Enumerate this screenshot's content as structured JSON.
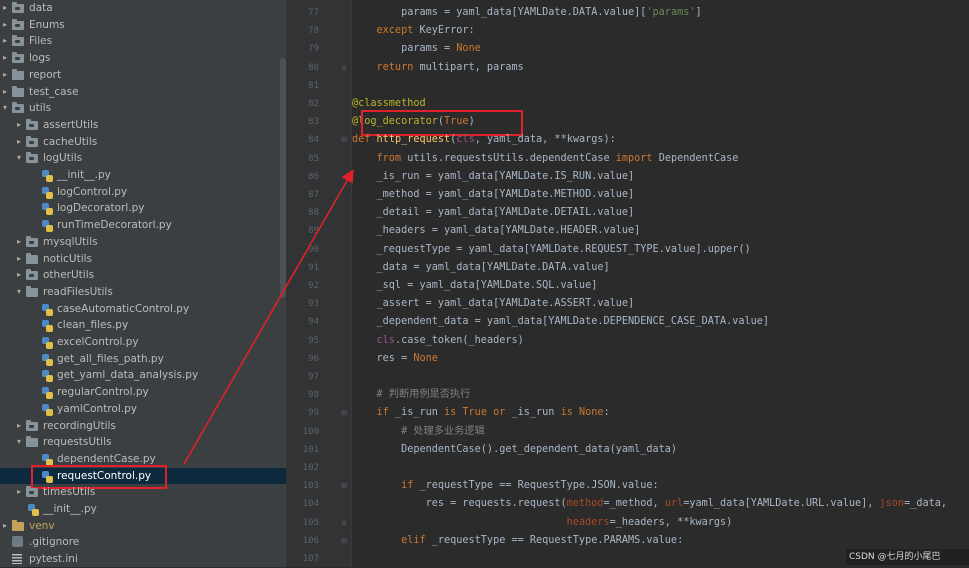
{
  "project_tree": [
    {
      "label": "data",
      "kind": "pkg",
      "depth": 0,
      "expanded": false
    },
    {
      "label": "Enums",
      "kind": "pkg",
      "depth": 0,
      "expanded": false
    },
    {
      "label": "Files",
      "kind": "pkg",
      "depth": 0,
      "expanded": false
    },
    {
      "label": "logs",
      "kind": "pkg",
      "depth": 0,
      "expanded": false
    },
    {
      "label": "report",
      "kind": "folder",
      "depth": 0,
      "expanded": false
    },
    {
      "label": "test_case",
      "kind": "folder",
      "depth": 0,
      "expanded": false
    },
    {
      "label": "utils",
      "kind": "pkg",
      "depth": 0,
      "expanded": true
    },
    {
      "label": "assertUtils",
      "kind": "pkg",
      "depth": 1,
      "expanded": false
    },
    {
      "label": "cacheUtils",
      "kind": "pkg",
      "depth": 1,
      "expanded": false
    },
    {
      "label": "logUtils",
      "kind": "pkg",
      "depth": 1,
      "expanded": true
    },
    {
      "label": "__init__.py",
      "kind": "py",
      "depth": 2
    },
    {
      "label": "logControl.py",
      "kind": "py",
      "depth": 2
    },
    {
      "label": "logDecoratorl.py",
      "kind": "py",
      "depth": 2
    },
    {
      "label": "runTimeDecoratorl.py",
      "kind": "py",
      "depth": 2
    },
    {
      "label": "mysqlUtils",
      "kind": "pkg",
      "depth": 1,
      "expanded": false
    },
    {
      "label": "noticUtils",
      "kind": "folder",
      "depth": 1,
      "expanded": false
    },
    {
      "label": "otherUtils",
      "kind": "pkg",
      "depth": 1,
      "expanded": false
    },
    {
      "label": "readFilesUtils",
      "kind": "folder",
      "depth": 1,
      "expanded": true
    },
    {
      "label": "caseAutomaticControl.py",
      "kind": "py",
      "depth": 2
    },
    {
      "label": "clean_files.py",
      "kind": "py",
      "depth": 2
    },
    {
      "label": "excelControl.py",
      "kind": "py",
      "depth": 2
    },
    {
      "label": "get_all_files_path.py",
      "kind": "py",
      "depth": 2
    },
    {
      "label": "get_yaml_data_analysis.py",
      "kind": "py",
      "depth": 2
    },
    {
      "label": "regularControl.py",
      "kind": "py",
      "depth": 2
    },
    {
      "label": "yamlControl.py",
      "kind": "py",
      "depth": 2
    },
    {
      "label": "recordingUtils",
      "kind": "pkg",
      "depth": 1,
      "expanded": false
    },
    {
      "label": "requestsUtils",
      "kind": "folder",
      "depth": 1,
      "expanded": true
    },
    {
      "label": "dependentCase.py",
      "kind": "py",
      "depth": 2
    },
    {
      "label": "requestControl.py",
      "kind": "py",
      "depth": 2,
      "selected": true,
      "highlighted": true
    },
    {
      "label": "timesUtils",
      "kind": "pkg",
      "depth": 1,
      "expanded": false
    },
    {
      "label": "__init__.py",
      "kind": "py",
      "depth": 1
    },
    {
      "label": "venv",
      "kind": "venv",
      "depth": 0,
      "expanded": false
    },
    {
      "label": ".gitignore",
      "kind": "git",
      "depth": 0
    },
    {
      "label": "pytest.ini",
      "kind": "ini",
      "depth": 0
    }
  ],
  "editor": {
    "lines": [
      {
        "n": "77",
        "fold": "",
        "tokens": [
          [
            "default",
            "        params = yaml_data[YAMLDate.DATA.value]["
          ],
          [
            "str",
            "'params'"
          ],
          [
            "default",
            "]"
          ]
        ]
      },
      {
        "n": "78",
        "fold": "",
        "tokens": [
          [
            "kw",
            "    except "
          ],
          [
            "default",
            "KeyError:"
          ]
        ]
      },
      {
        "n": "79",
        "fold": "",
        "tokens": [
          [
            "default",
            "        params = "
          ],
          [
            "kw",
            "None"
          ]
        ]
      },
      {
        "n": "80",
        "fold": "⌂",
        "tokens": [
          [
            "kw",
            "    return "
          ],
          [
            "default",
            "multipart, params"
          ]
        ]
      },
      {
        "n": "81",
        "fold": "",
        "tokens": []
      },
      {
        "n": "82",
        "fold": "",
        "tokens": [
          [
            "deco",
            "@classmethod"
          ]
        ]
      },
      {
        "n": "83",
        "fold": "",
        "highlighted": true,
        "tokens": [
          [
            "deco",
            "@log_decorator"
          ],
          [
            "default",
            "("
          ],
          [
            "kw",
            "True"
          ],
          [
            "default",
            ")"
          ]
        ]
      },
      {
        "n": "84",
        "fold": "⊖",
        "tokens": [
          [
            "kw",
            "def "
          ],
          [
            "fn",
            "http_request"
          ],
          [
            "default",
            "("
          ],
          [
            "self",
            "cls"
          ],
          [
            "default",
            ", yaml_data, **kwargs):"
          ]
        ]
      },
      {
        "n": "85",
        "fold": "",
        "tokens": [
          [
            "kw",
            "    from "
          ],
          [
            "default",
            "utils.requestsUtils.dependentCase "
          ],
          [
            "kw",
            "import "
          ],
          [
            "default",
            "DependentCase"
          ]
        ]
      },
      {
        "n": "86",
        "fold": "",
        "tokens": [
          [
            "default",
            "    _is_run = yaml_data[YAMLDate.IS_RUN.value]"
          ]
        ]
      },
      {
        "n": "87",
        "fold": "",
        "tokens": [
          [
            "default",
            "    _method = yaml_data[YAMLDate.METHOD.value]"
          ]
        ]
      },
      {
        "n": "88",
        "fold": "",
        "tokens": [
          [
            "default",
            "    _detail = yaml_data[YAMLDate.DETAIL.value]"
          ]
        ]
      },
      {
        "n": "89",
        "fold": "",
        "tokens": [
          [
            "default",
            "    _headers = yaml_data[YAMLDate.HEADER.value]"
          ]
        ]
      },
      {
        "n": "90",
        "fold": "",
        "tokens": [
          [
            "default",
            "    _requestType = yaml_data[YAMLDate.REQUEST_TYPE.value].upper()"
          ]
        ]
      },
      {
        "n": "91",
        "fold": "",
        "tokens": [
          [
            "default",
            "    _data = yaml_data[YAMLDate.DATA.value]"
          ]
        ]
      },
      {
        "n": "92",
        "fold": "",
        "tokens": [
          [
            "default",
            "    _sql = yaml_data[YAMLDate.SQL.value]"
          ]
        ]
      },
      {
        "n": "93",
        "fold": "",
        "tokens": [
          [
            "default",
            "    _assert = yaml_data[YAMLDate.ASSERT.value]"
          ]
        ]
      },
      {
        "n": "94",
        "fold": "",
        "tokens": [
          [
            "default",
            "    _dependent_data = yaml_data[YAMLDate.DEPENDENCE_CASE_DATA.value]"
          ]
        ]
      },
      {
        "n": "95",
        "fold": "",
        "tokens": [
          [
            "self",
            "    cls"
          ],
          [
            "default",
            ".case_token(_headers)"
          ]
        ]
      },
      {
        "n": "96",
        "fold": "",
        "tokens": [
          [
            "default",
            "    res = "
          ],
          [
            "kw",
            "None"
          ]
        ]
      },
      {
        "n": "97",
        "fold": "",
        "tokens": []
      },
      {
        "n": "98",
        "fold": "",
        "tokens": [
          [
            "comment",
            "    # 判断用例是否执行"
          ]
        ]
      },
      {
        "n": "99",
        "fold": "⊖",
        "tokens": [
          [
            "kw",
            "    if "
          ],
          [
            "default",
            "_is_run "
          ],
          [
            "kw",
            "is True or "
          ],
          [
            "default",
            "_is_run "
          ],
          [
            "kw",
            "is None"
          ],
          [
            "default",
            ":"
          ]
        ]
      },
      {
        "n": "100",
        "fold": "",
        "tokens": [
          [
            "comment",
            "        # 处理多业务逻辑"
          ]
        ]
      },
      {
        "n": "101",
        "fold": "",
        "tokens": [
          [
            "default",
            "        DependentCase().get_dependent_data(yaml_data)"
          ]
        ]
      },
      {
        "n": "102",
        "fold": "",
        "tokens": []
      },
      {
        "n": "103",
        "fold": "⊖",
        "tokens": [
          [
            "kw",
            "        if "
          ],
          [
            "default",
            "_requestType == RequestType.JSON.value:"
          ]
        ]
      },
      {
        "n": "104",
        "fold": "",
        "tokens": [
          [
            "default",
            "            res = requests.request("
          ],
          [
            "param",
            "method"
          ],
          [
            "default",
            "=_method, "
          ],
          [
            "param",
            "url"
          ],
          [
            "default",
            "=yaml_data[YAMLDate.URL.value], "
          ],
          [
            "param",
            "json"
          ],
          [
            "default",
            "=_data,"
          ]
        ]
      },
      {
        "n": "105",
        "fold": "⌂",
        "tokens": [
          [
            "default",
            "                                   "
          ],
          [
            "param",
            "headers"
          ],
          [
            "default",
            "=_headers, **kwargs)"
          ]
        ]
      },
      {
        "n": "106",
        "fold": "⊖",
        "tokens": [
          [
            "kw",
            "        elif "
          ],
          [
            "default",
            "_requestType == RequestType.PARAMS.value:"
          ]
        ]
      },
      {
        "n": "107",
        "fold": "",
        "tokens": []
      }
    ]
  },
  "watermark": "CSDN @七月的小尾巴",
  "accent_color": "#e0202a"
}
